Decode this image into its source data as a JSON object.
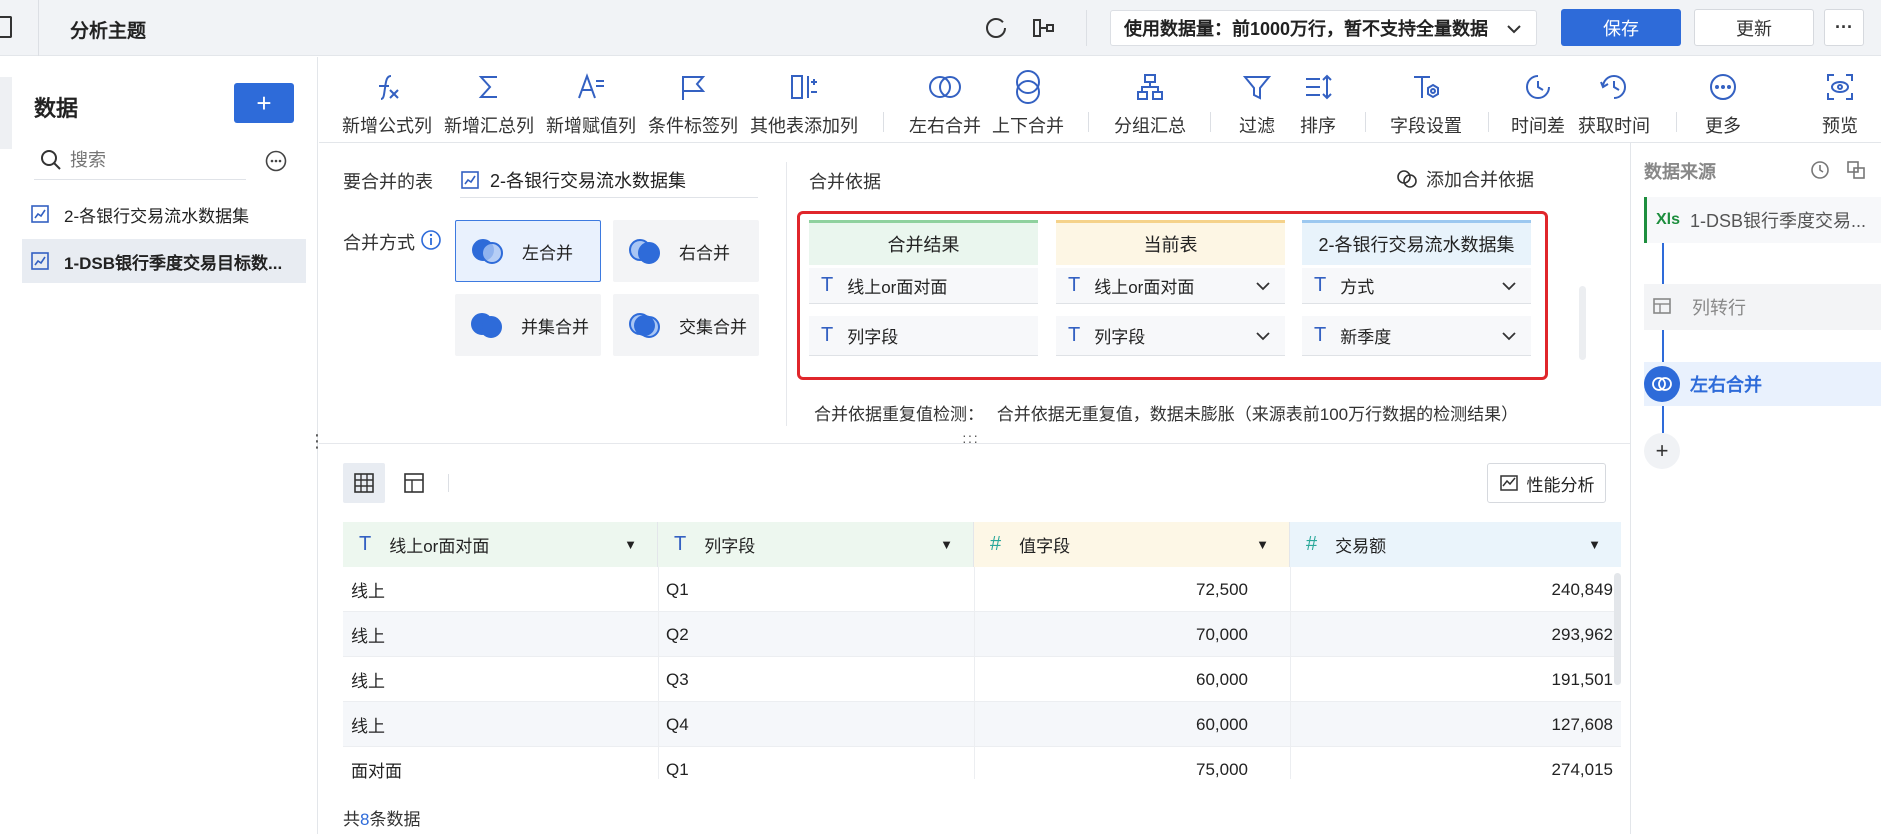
{
  "header": {
    "title": "分析主题",
    "data_usage": "使用数据量：前1000万行，暂不支持全量数据",
    "save_label": "保存",
    "update_label": "更新",
    "more_label": "···"
  },
  "sidebar": {
    "title": "数据",
    "add_label": "+",
    "search_placeholder": "搜索",
    "items": [
      {
        "label": "2-各银行交易流水数据集"
      },
      {
        "label": "1-DSB银行季度交易目标数..."
      }
    ]
  },
  "toolbar": {
    "items": [
      {
        "label": "新增公式列",
        "icon": "formula-icon"
      },
      {
        "label": "新增汇总列",
        "icon": "sigma-icon"
      },
      {
        "label": "新增赋值列",
        "icon": "assign-icon"
      },
      {
        "label": "条件标签列",
        "icon": "flag-icon"
      },
      {
        "label": "其他表添加列",
        "icon": "add-column-icon"
      },
      {
        "label": "左右合并",
        "icon": "horizontal-merge-icon"
      },
      {
        "label": "上下合并",
        "icon": "vertical-merge-icon"
      },
      {
        "label": "分组汇总",
        "icon": "group-icon"
      },
      {
        "label": "过滤",
        "icon": "filter-icon"
      },
      {
        "label": "排序",
        "icon": "sort-icon"
      },
      {
        "label": "字段设置",
        "icon": "field-settings-icon"
      },
      {
        "label": "时间差",
        "icon": "time-diff-icon"
      },
      {
        "label": "获取时间",
        "icon": "get-time-icon"
      },
      {
        "label": "更多",
        "icon": "more-icon"
      },
      {
        "label": "预览",
        "icon": "preview-icon"
      }
    ]
  },
  "merge": {
    "table_label": "要合并的表",
    "table_value": "2-各银行交易流水数据集",
    "method_label": "合并方式",
    "methods": [
      {
        "label": "左合并",
        "selected": true
      },
      {
        "label": "右合并",
        "selected": false
      },
      {
        "label": "并集合并",
        "selected": false
      },
      {
        "label": "交集合并",
        "selected": false
      }
    ],
    "basis_label": "合并依据",
    "add_basis_label": "添加合并依据",
    "columns": [
      {
        "header": "合并结果",
        "color": "#8fd19e"
      },
      {
        "header": "当前表",
        "color": "#f5d28a"
      },
      {
        "header": "2-各银行交易流水数据集",
        "color": "#9cc8f0"
      }
    ],
    "rows": [
      [
        "线上or面对面",
        "线上or面对面",
        "方式"
      ],
      [
        "列字段",
        "列字段",
        "新季度"
      ]
    ],
    "check_label": "合并依据重复值检测：",
    "check_result": "合并依据无重复值，数据未膨胀（来源表前100万行数据的检测结果）"
  },
  "grid": {
    "perf_label": "性能分析",
    "columns": [
      {
        "label": "线上or面对面",
        "type": "T",
        "color": "#edf7ef"
      },
      {
        "label": "列字段",
        "type": "T",
        "color": "#edf7ef"
      },
      {
        "label": "值字段",
        "type": "#",
        "color": "#fdf7e6"
      },
      {
        "label": "交易额",
        "type": "#",
        "color": "#eaf4fb"
      }
    ],
    "rows": [
      [
        "线上",
        "Q1",
        "72,500",
        "240,849"
      ],
      [
        "线上",
        "Q2",
        "70,000",
        "293,962"
      ],
      [
        "线上",
        "Q3",
        "60,000",
        "191,501"
      ],
      [
        "线上",
        "Q4",
        "60,000",
        "127,608"
      ],
      [
        "面对面",
        "Q1",
        "75,000",
        "274,015"
      ]
    ],
    "total_prefix": "共",
    "total_count": "8",
    "total_suffix": "条数据"
  },
  "flow": {
    "title": "数据来源",
    "source_badge": "Xls",
    "source_label": "1-DSB银行季度交易...",
    "steps": [
      {
        "label": "列转行",
        "active": false
      },
      {
        "label": "左右合并",
        "active": true
      }
    ],
    "add_label": "+"
  }
}
